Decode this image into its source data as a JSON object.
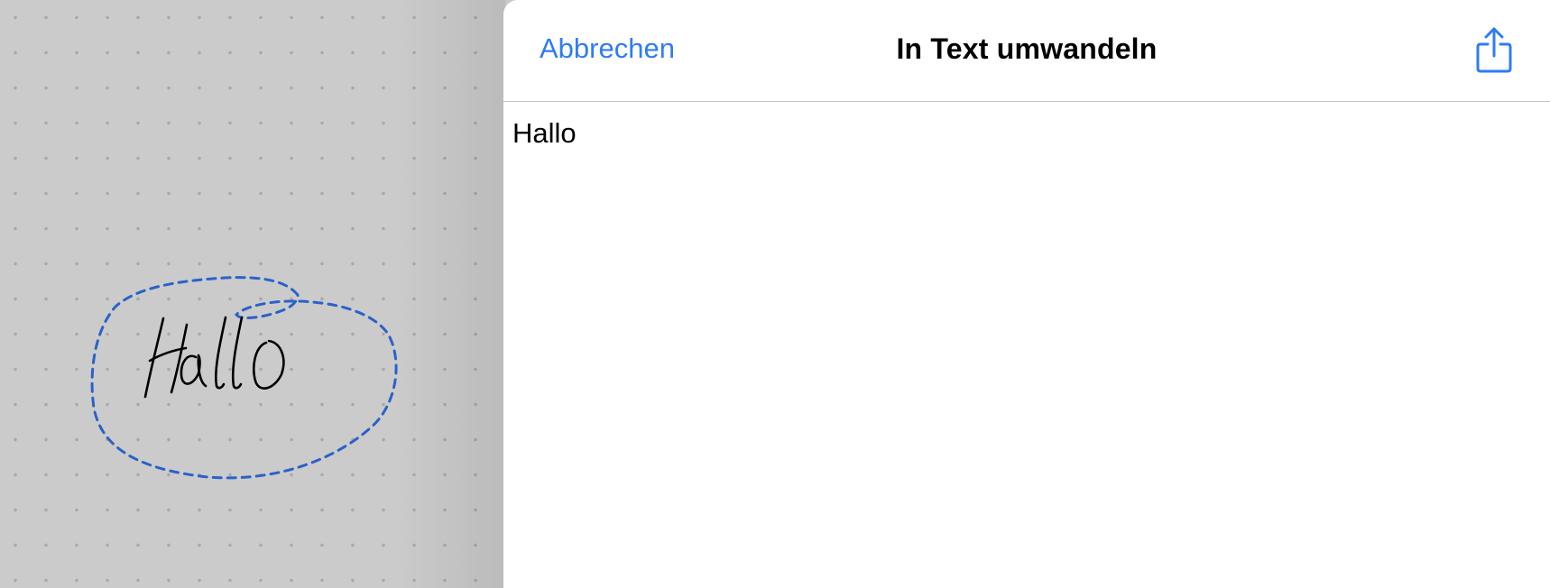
{
  "canvas": {
    "handwriting_text": "Hallo",
    "lasso_color": "#2a62c9",
    "ink_color": "#000000"
  },
  "sheet": {
    "cancel_label": "Abbrechen",
    "title": "In Text umwandeln",
    "share_icon": "share-icon",
    "recognized_text": "Hallo",
    "accent_color": "#2f7bf6"
  }
}
